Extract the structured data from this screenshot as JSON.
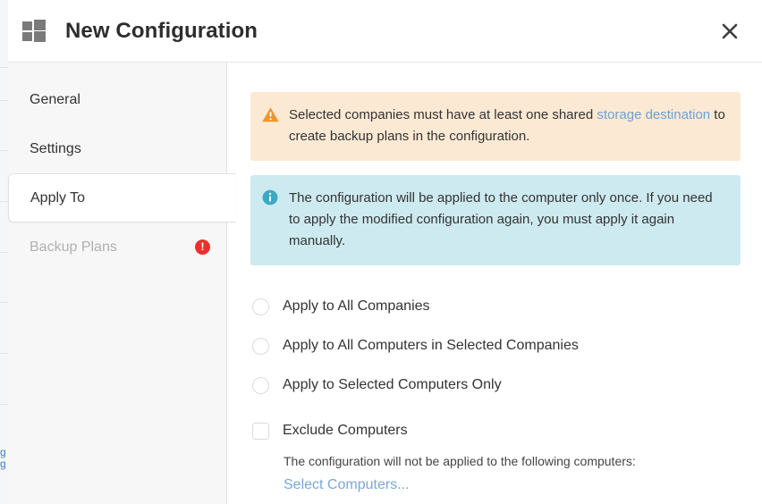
{
  "background": {
    "fragment_line1": "g",
    "fragment_line2": "g"
  },
  "header": {
    "icon": "windows-logo-icon",
    "title": "New Configuration",
    "close_icon": "close-icon",
    "close_label": "✕"
  },
  "sidebar": {
    "items": [
      {
        "label": "General",
        "active": false,
        "disabled": false,
        "badge": null
      },
      {
        "label": "Settings",
        "active": false,
        "disabled": false,
        "badge": null
      },
      {
        "label": "Apply To",
        "active": true,
        "disabled": false,
        "badge": null
      },
      {
        "label": "Backup Plans",
        "active": false,
        "disabled": true,
        "badge": "!"
      }
    ]
  },
  "content": {
    "banners": [
      {
        "type": "warning",
        "icon": "warning-triangle-icon",
        "text_before": "Selected companies must have at least one shared ",
        "link_text": "storage destination",
        "text_after": " to create backup plans in the configuration."
      },
      {
        "type": "info",
        "icon": "info-circle-icon",
        "text": "The configuration will be applied to the computer only once. If you need to apply the modified configuration again, you must apply it again manually."
      }
    ],
    "radio_options": [
      {
        "label": "Apply to All Companies",
        "checked": false
      },
      {
        "label": "Apply to All Computers in Selected Companies",
        "checked": false
      },
      {
        "label": "Apply to Selected Computers Only",
        "checked": false
      }
    ],
    "exclude": {
      "checkbox_label": "Exclude Computers",
      "checked": false,
      "note": "The configuration will not be applied to the following computers:",
      "link_label": "Select Computers..."
    }
  },
  "colors": {
    "warning_bg": "#fce9d4",
    "warning_icon": "#f0952b",
    "info_bg": "#cdeaf0",
    "info_icon": "#3ba9c4",
    "link": "#7ba7d7",
    "error_badge": "#e8312f",
    "sidebar_bg": "#f7f7f7"
  }
}
